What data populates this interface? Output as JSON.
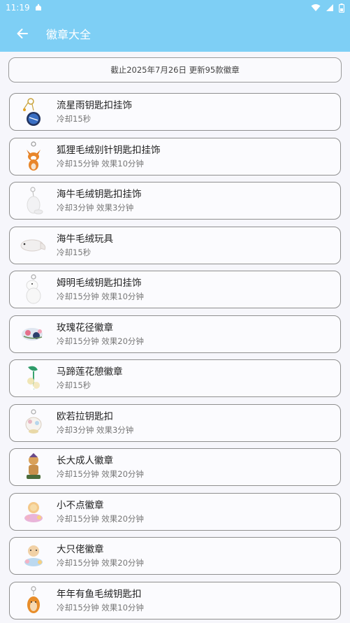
{
  "status": {
    "time": "11:19"
  },
  "appbar": {
    "title": "徽章大全"
  },
  "notice": "截止2025年7月26日 更新95款徽章",
  "items": [
    {
      "name": "流星雨钥匙扣挂饰",
      "desc": "冷却15秒",
      "icon": "meteor-keychain-icon"
    },
    {
      "name": "狐狸毛绒别针钥匙扣挂饰",
      "desc": "冷却15分钟 效果10分钟",
      "icon": "fox-plush-icon"
    },
    {
      "name": "海牛毛绒钥匙扣挂饰",
      "desc": "冷却3分钟 效果3分钟",
      "icon": "manatee-keychain-icon"
    },
    {
      "name": "海牛毛绒玩具",
      "desc": "冷却15秒",
      "icon": "manatee-plush-icon"
    },
    {
      "name": "姆明毛绒钥匙扣挂饰",
      "desc": "冷却15分钟 效果10分钟",
      "icon": "moomin-plush-icon"
    },
    {
      "name": "玫瑰花径徽章",
      "desc": "冷却15分钟 效果20分钟",
      "icon": "rose-path-badge-icon"
    },
    {
      "name": "马蹄莲花憩徽章",
      "desc": "冷却15秒",
      "icon": "calla-lily-badge-icon"
    },
    {
      "name": "欧若拉钥匙扣",
      "desc": "冷却3分钟 效果3分钟",
      "icon": "aurora-keychain-icon"
    },
    {
      "name": "长大成人徽章",
      "desc": "冷却15分钟 效果20分钟",
      "icon": "grown-up-badge-icon"
    },
    {
      "name": "小不点徽章",
      "desc": "冷却15分钟 效果20分钟",
      "icon": "little-one-badge-icon"
    },
    {
      "name": "大只佬徽章",
      "desc": "冷却15分钟 效果20分钟",
      "icon": "big-guy-badge-icon"
    },
    {
      "name": "年年有鱼毛绒钥匙扣",
      "desc": "冷却15分钟 效果10分钟",
      "icon": "fish-plush-icon"
    }
  ]
}
